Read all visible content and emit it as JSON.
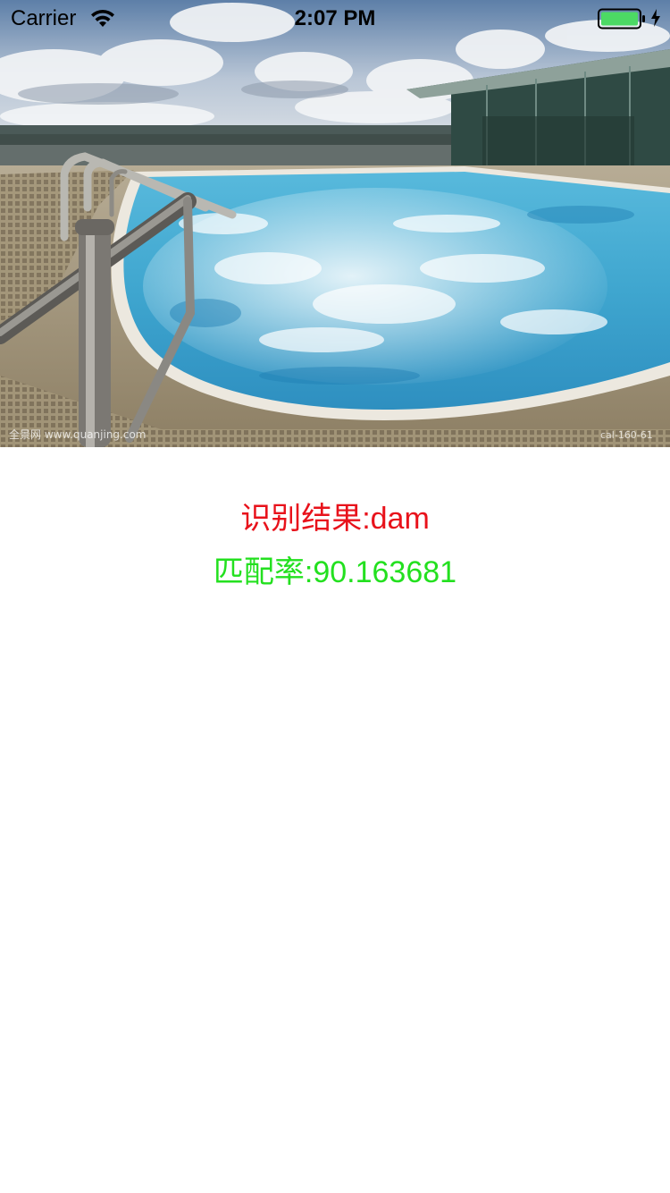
{
  "status_bar": {
    "carrier": "Carrier",
    "time": "2:07 PM",
    "wifi_icon": "wifi-icon",
    "battery_icon": "battery-full-icon",
    "charging_icon": "charging-bolt-icon",
    "battery_level": 1.0
  },
  "photo": {
    "description_icon": "pool-photo",
    "watermark_left": "全景网 www.quanjing.com",
    "watermark_right": "cal-160-61"
  },
  "result": {
    "recognition": "识别结果:dam",
    "match_rate": "匹配率:90.163681"
  },
  "colors": {
    "recognition_text": "#e8121b",
    "match_rate_text": "#23e01f",
    "battery_fill": "#4cd964",
    "background": "#ffffff"
  }
}
